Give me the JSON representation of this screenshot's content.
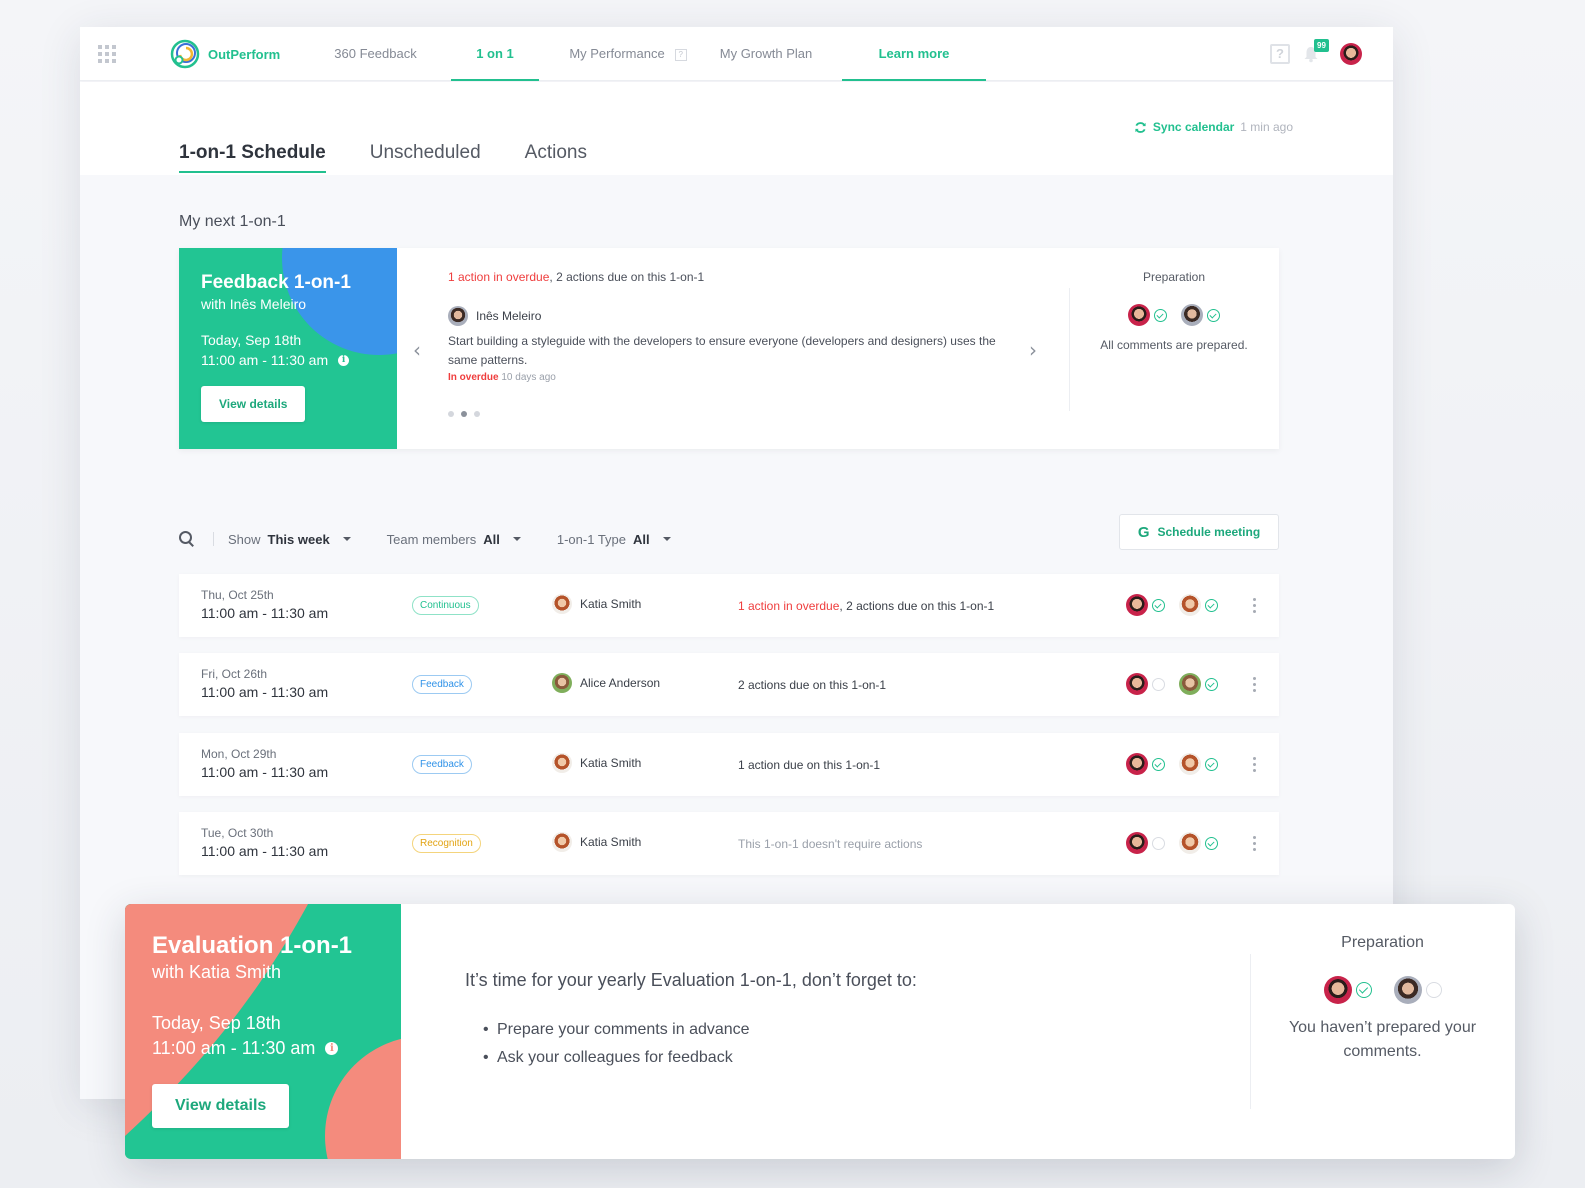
{
  "app": {
    "name": "OutPerform",
    "notifications_count": "99"
  },
  "nav": {
    "items": [
      {
        "label": "360 Feedback",
        "active": false
      },
      {
        "label": "1 on 1",
        "active": true
      },
      {
        "label": "My Performance",
        "active": false
      },
      {
        "label": "My Growth Plan",
        "active": false
      },
      {
        "label": "Learn more",
        "active": true
      }
    ],
    "help_glyph": "?"
  },
  "sync": {
    "label": "Sync calendar",
    "time": "1 min ago"
  },
  "tabs": [
    {
      "label": "1-on-1 Schedule",
      "active": true
    },
    {
      "label": "Unscheduled",
      "active": false
    },
    {
      "label": "Actions",
      "active": false
    }
  ],
  "next": {
    "section_title": "My next 1-on-1",
    "title": "Feedback 1-on-1",
    "with": "with Inês Meleiro",
    "date": "Today, Sep 18th",
    "time": "11:00 am  - 11:30 am",
    "view_details": "View details",
    "summary_overdue": "1 action in overdue",
    "summary_rest": ", 2 actions due on this 1-on-1",
    "action_person": "Inês Meleiro",
    "action_text": "Start building a styleguide with the developers to ensure everyone (developers and designers) uses the same patterns.",
    "action_status": "In overdue",
    "action_age": "10 days ago",
    "carousel_active_index": 1,
    "carousel_count": 3,
    "preparation_title": "Preparation",
    "preparation_msg": "All comments are prepared."
  },
  "filters": {
    "show_label": "Show",
    "show_value": "This week",
    "team_label": "Team members",
    "team_value": "All",
    "type_label": "1-on-1 Type",
    "type_value": "All",
    "schedule_button": "Schedule meeting",
    "schedule_icon": "G"
  },
  "rows": [
    {
      "day": "Thu, Oct 25th",
      "time": "11:00 am  - 11:30 am",
      "type": "Continuous",
      "person": "Katia Smith",
      "actions_overdue": "1 action in overdue",
      "actions_text": ", 2 actions due on this 1-on-1",
      "prep_me": true,
      "prep_other": true
    },
    {
      "day": "Fri, Oct 26th",
      "time": "11:00 am  - 11:30 am",
      "type": "Feedback",
      "person": "Alice Anderson",
      "actions_overdue": "",
      "actions_text": "2 actions due on this 1-on-1",
      "prep_me": false,
      "prep_other": true
    },
    {
      "day": "Mon, Oct 29th",
      "time": "11:00 am  - 11:30 am",
      "type": "Feedback",
      "person": "Katia Smith",
      "actions_overdue": "",
      "actions_text": "1 action due on this 1-on-1",
      "prep_me": true,
      "prep_other": true
    },
    {
      "day": "Tue, Oct 30th",
      "time": "11:00 am  - 11:30 am",
      "type": "Recognition",
      "person": "Katia Smith",
      "actions_overdue": "",
      "actions_text": "This 1-on-1 doesn't require actions",
      "prep_me": false,
      "prep_other": true
    }
  ],
  "evaluation": {
    "title": "Evaluation 1-on-1",
    "with": "with Katia Smith",
    "date": "Today, Sep 18th",
    "time": "11:00 am  - 11:30 am",
    "view_details": "View details",
    "lead": "It’s time for your yearly Evaluation 1-on-1, don’t forget to:",
    "bullets": [
      "Prepare your comments in advance",
      "Ask your colleagues for feedback"
    ],
    "preparation_title": "Preparation",
    "preparation_msg": "You haven’t prepared your comments."
  },
  "colors": {
    "brand": "#22c08f",
    "blue": "#3a95ea",
    "coral": "#f48b7d",
    "overdue": "#ef3d3d"
  }
}
